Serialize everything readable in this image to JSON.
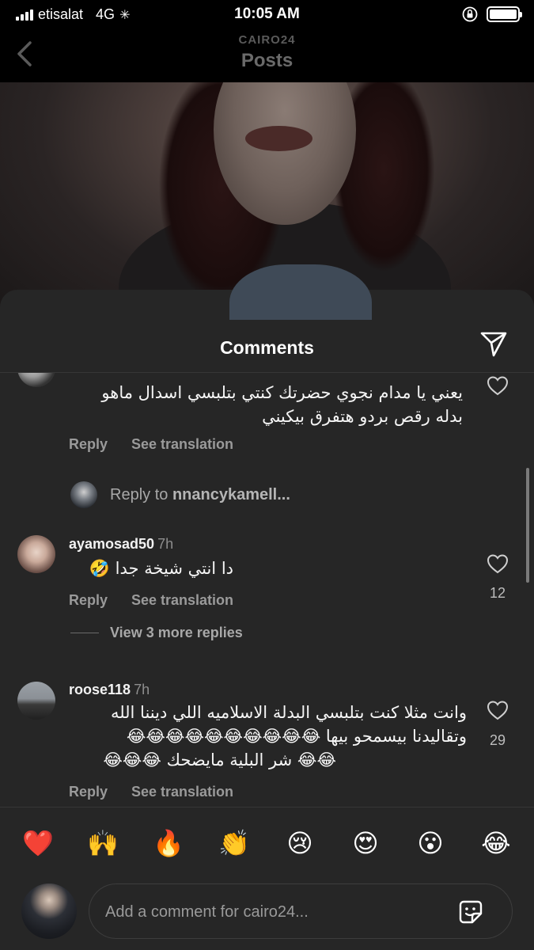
{
  "status_bar": {
    "carrier": "etisalat",
    "network": "4G",
    "time": "10:05 AM"
  },
  "nav": {
    "subtitle": "CAIRO24",
    "title": "Posts"
  },
  "sheet": {
    "title": "Comments"
  },
  "comments": [
    {
      "text_line1": "يعني يا مدام نجوي حضرتك كنتي بتلبسي اسدال ماهو",
      "text_line2": "بدله رقص بردو هتفرق بيكيني",
      "reply": "Reply",
      "see_translation": "See translation"
    },
    {
      "username": "ayamosad50",
      "time": "7h",
      "text": "دا انتي شيخة جدا 🤣",
      "likes": "12",
      "reply": "Reply",
      "see_translation": "See translation"
    },
    {
      "username": "roose118",
      "time": "7h",
      "text_line1": "وانت مثلا كنت بتلبسي البدلة الاسلاميه اللي ديننا الله",
      "text_line2": "وتقاليدنا بيسمحو بيها 😂😂😂😂😂😂😂😂😂😂",
      "text_line3": "😂😂 شر البلية مايضحك 😂😂😂",
      "likes": "29",
      "reply": "Reply",
      "see_translation": "See translation"
    }
  ],
  "reply_prompt": {
    "prefix": "Reply to",
    "target": "nnancykamell..."
  },
  "view_more": "View 3 more replies",
  "emoji_bar": [
    "❤️",
    "🙌",
    "🔥",
    "👏",
    "😢",
    "😍",
    "😮",
    "😂"
  ],
  "input": {
    "placeholder": "Add a comment for cairo24..."
  }
}
